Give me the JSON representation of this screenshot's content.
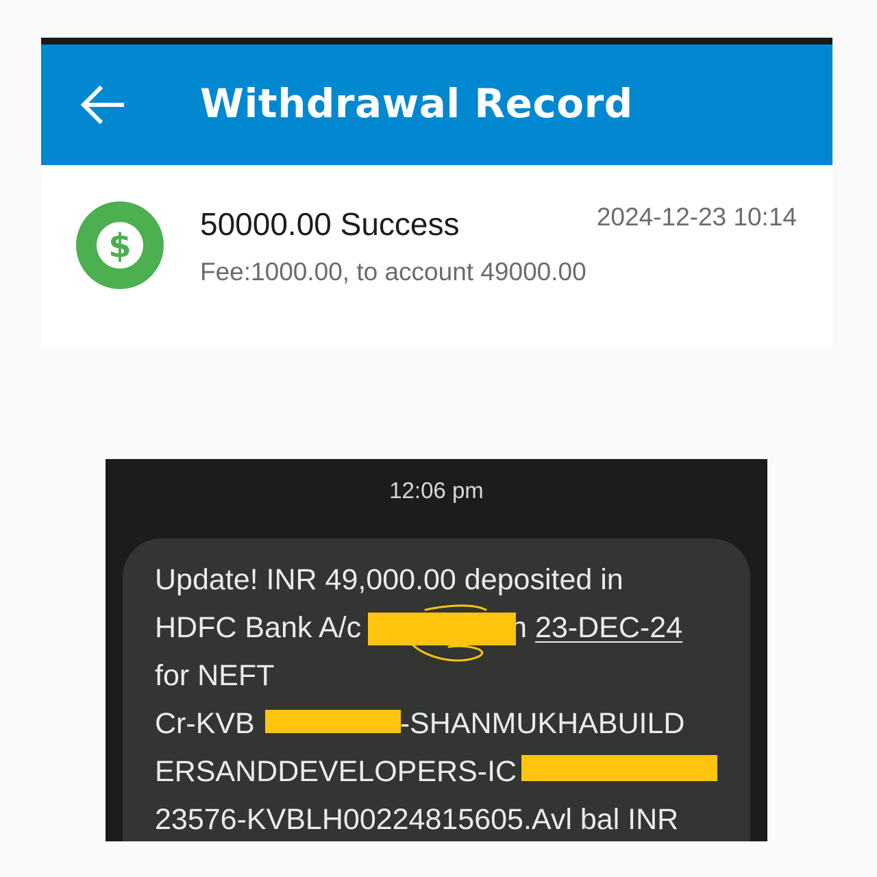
{
  "withdrawal_screen": {
    "title": "Withdrawal Record",
    "record": {
      "amount_status": "50000.00 Success",
      "datetime": "2024-12-23 10:14",
      "fee_line": "Fee:1000.00, to account 49000.00"
    },
    "colors": {
      "appbar": "#0288d1",
      "icon_circle": "#4caf50"
    },
    "icons": {
      "back": "arrow-left-icon",
      "record": "dollar-coin-icon"
    }
  },
  "sms_screen": {
    "time": "12:06 pm",
    "message_lines": {
      "line1": "Update! INR 49,000.00 deposited in",
      "line2_prefix": "HDFC Bank A/c",
      "line2_suffix": "n",
      "line2_date": "23-DEC-24",
      "line3": "for NEFT",
      "line4_prefix": "Cr-KVB",
      "line4_suffix": "-SHANMUKHABUILD",
      "line5_prefix": "ERSANDDEVELOPERS-IC",
      "line6": "23576-KVBLH00224815605.Avl bal INR"
    },
    "colors": {
      "background": "#1b1d1b",
      "bubble": "#323532",
      "redaction": "#ffc40d"
    }
  }
}
